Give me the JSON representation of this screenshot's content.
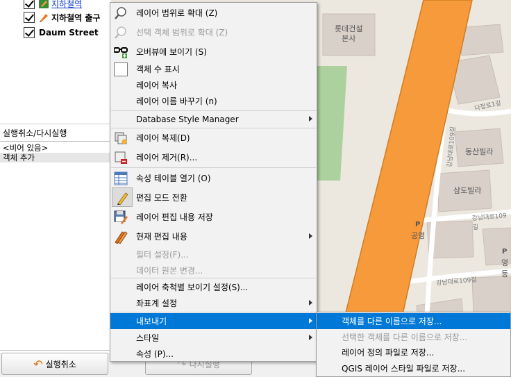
{
  "layers": [
    {
      "label": "지하철역",
      "icon": "pencil-layer-icon"
    },
    {
      "label": "지하철역 출구",
      "icon": "pencil-layer-icon"
    },
    {
      "label": "Daum Street",
      "icon": "none"
    }
  ],
  "undo": {
    "title": "실행취소/다시실행",
    "items": [
      "<비어 있음>",
      "객체 추가"
    ],
    "undo_label": "실행취소",
    "redo_label": "다시실행"
  },
  "map": {
    "labels": [
      "롯데건설",
      "본사",
      "동산빌라",
      "삼도빌라",
      "P",
      "공영",
      "P",
      "영등",
      "다정로1길",
      "강남대로109길",
      "강남대로109길",
      "강남대로109길"
    ]
  },
  "context_menu": {
    "items": [
      {
        "label": "레이어 범위로 확대 (Z)",
        "icon": "zoom-to-layer-icon",
        "enabled": true
      },
      {
        "label": "선택 객체 범위로 확대 (Z)",
        "icon": "zoom-to-selection-icon",
        "enabled": false
      },
      {
        "label": "오버뷰에 보이기 (S)",
        "icon": "overview-glasses-icon",
        "enabled": true
      },
      {
        "label": "객체 수 표시",
        "icon": "checkbox-icon",
        "enabled": true
      },
      {
        "label": "레이어 복사",
        "enabled": true
      },
      {
        "label": "레이어 이름 바꾸기 (n)",
        "enabled": true
      },
      {
        "label": "Database Style Manager",
        "enabled": true,
        "submenu": true
      },
      {
        "label": "레이어 복제(D)",
        "icon": "duplicate-layer-icon",
        "enabled": true
      },
      {
        "label": "레이어 제거(R)...",
        "icon": "remove-layer-icon",
        "enabled": true
      },
      {
        "label": "속성 테이블 열기 (O)",
        "icon": "attribute-table-icon",
        "enabled": true
      },
      {
        "label": "편집 모드 전환",
        "icon": "toggle-edit-pencil-icon",
        "enabled": true
      },
      {
        "label": "레이어 편집 내용 저장",
        "icon": "save-edits-icon",
        "enabled": true
      },
      {
        "label": "현재 편집 내용",
        "icon": "current-edits-icon",
        "enabled": true,
        "submenu": true
      },
      {
        "label": "필터 설정(F)...",
        "enabled": false
      },
      {
        "label": "데이터 원본 변경...",
        "enabled": false
      },
      {
        "label": "레이어 축척별 보이기 설정(S)...",
        "enabled": true
      },
      {
        "label": "좌표계 설정",
        "enabled": true,
        "submenu": true
      },
      {
        "label": "내보내기",
        "enabled": true,
        "submenu": true,
        "highlighted": true
      },
      {
        "label": "스타일",
        "enabled": true,
        "submenu": true
      },
      {
        "label": "속성 (P)...",
        "enabled": true
      }
    ]
  },
  "export_submenu": {
    "items": [
      {
        "label": "객체를 다른 이름으로 저장...",
        "enabled": true,
        "highlighted": true
      },
      {
        "label": "선택한 객체를 다른 이름으로 저장...",
        "enabled": false
      },
      {
        "label": "레이어 정의 파일로 저장...",
        "enabled": true
      },
      {
        "label": "QGIS 레이어 스타일 파일로 저장...",
        "enabled": true
      }
    ]
  },
  "colors": {
    "highlight": "#0078d7",
    "road": "#f79a3c",
    "park": "#add19e"
  }
}
